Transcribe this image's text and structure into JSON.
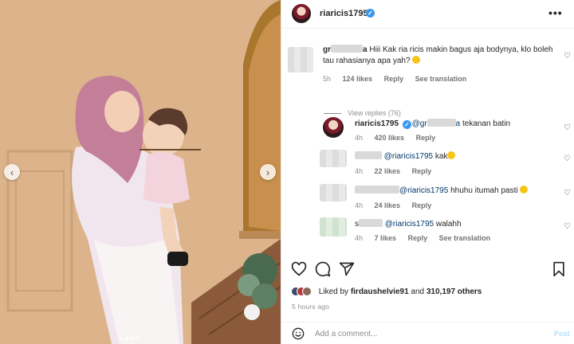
{
  "post": {
    "username": "riaricis1795",
    "carousel": {
      "slide_count": 4,
      "active_index": 1
    }
  },
  "comments": [
    {
      "user_visible": "gr",
      "user_tail": "a",
      "text": "Hiii Kak ria ricis makin bagus aja bodynya, klo boleh tau rahasianya apa yah?",
      "time": "5h",
      "likes": "124 likes",
      "reply": "Reply",
      "translate": "See translation",
      "view_replies": "View replies (76)"
    },
    {
      "user": "riaricis1795",
      "mention_visible": "@gr",
      "mention_tail": "a",
      "text": "tekanan batin",
      "time": "4h",
      "likes": "420 likes",
      "reply": "Reply"
    },
    {
      "user_visible": "",
      "mention": "@riaricis1795",
      "text": "kak",
      "time": "4h",
      "likes": "22 likes",
      "reply": "Reply"
    },
    {
      "user_visible": "",
      "mention": "@riaricis1795",
      "text": "hhuhu itumah pasti",
      "time": "4h",
      "likes": "24 likes",
      "reply": "Reply"
    },
    {
      "user_visible": "s",
      "mention": "@riaricis1795",
      "text": "walahh",
      "time": "4h",
      "likes": "7 likes",
      "reply": "Reply",
      "translate": "See translation"
    }
  ],
  "likes_line": {
    "prefix": "Liked by",
    "user": "firdaushelvie91",
    "middle": "and",
    "count": "310,197 others"
  },
  "time_ago": "5 hours ago",
  "add_comment": {
    "placeholder": "Add a comment...",
    "post_label": "Post"
  },
  "icons": {
    "heart": "heart-icon",
    "comment": "comment-icon",
    "share": "share-icon",
    "save": "bookmark-icon",
    "verified": "verified-badge-icon",
    "more": "more-icon",
    "emoji": "emoji-icon"
  },
  "colors": {
    "accent_blue": "#3897f0",
    "link": "#00376b",
    "muted": "#8e8e8e"
  }
}
